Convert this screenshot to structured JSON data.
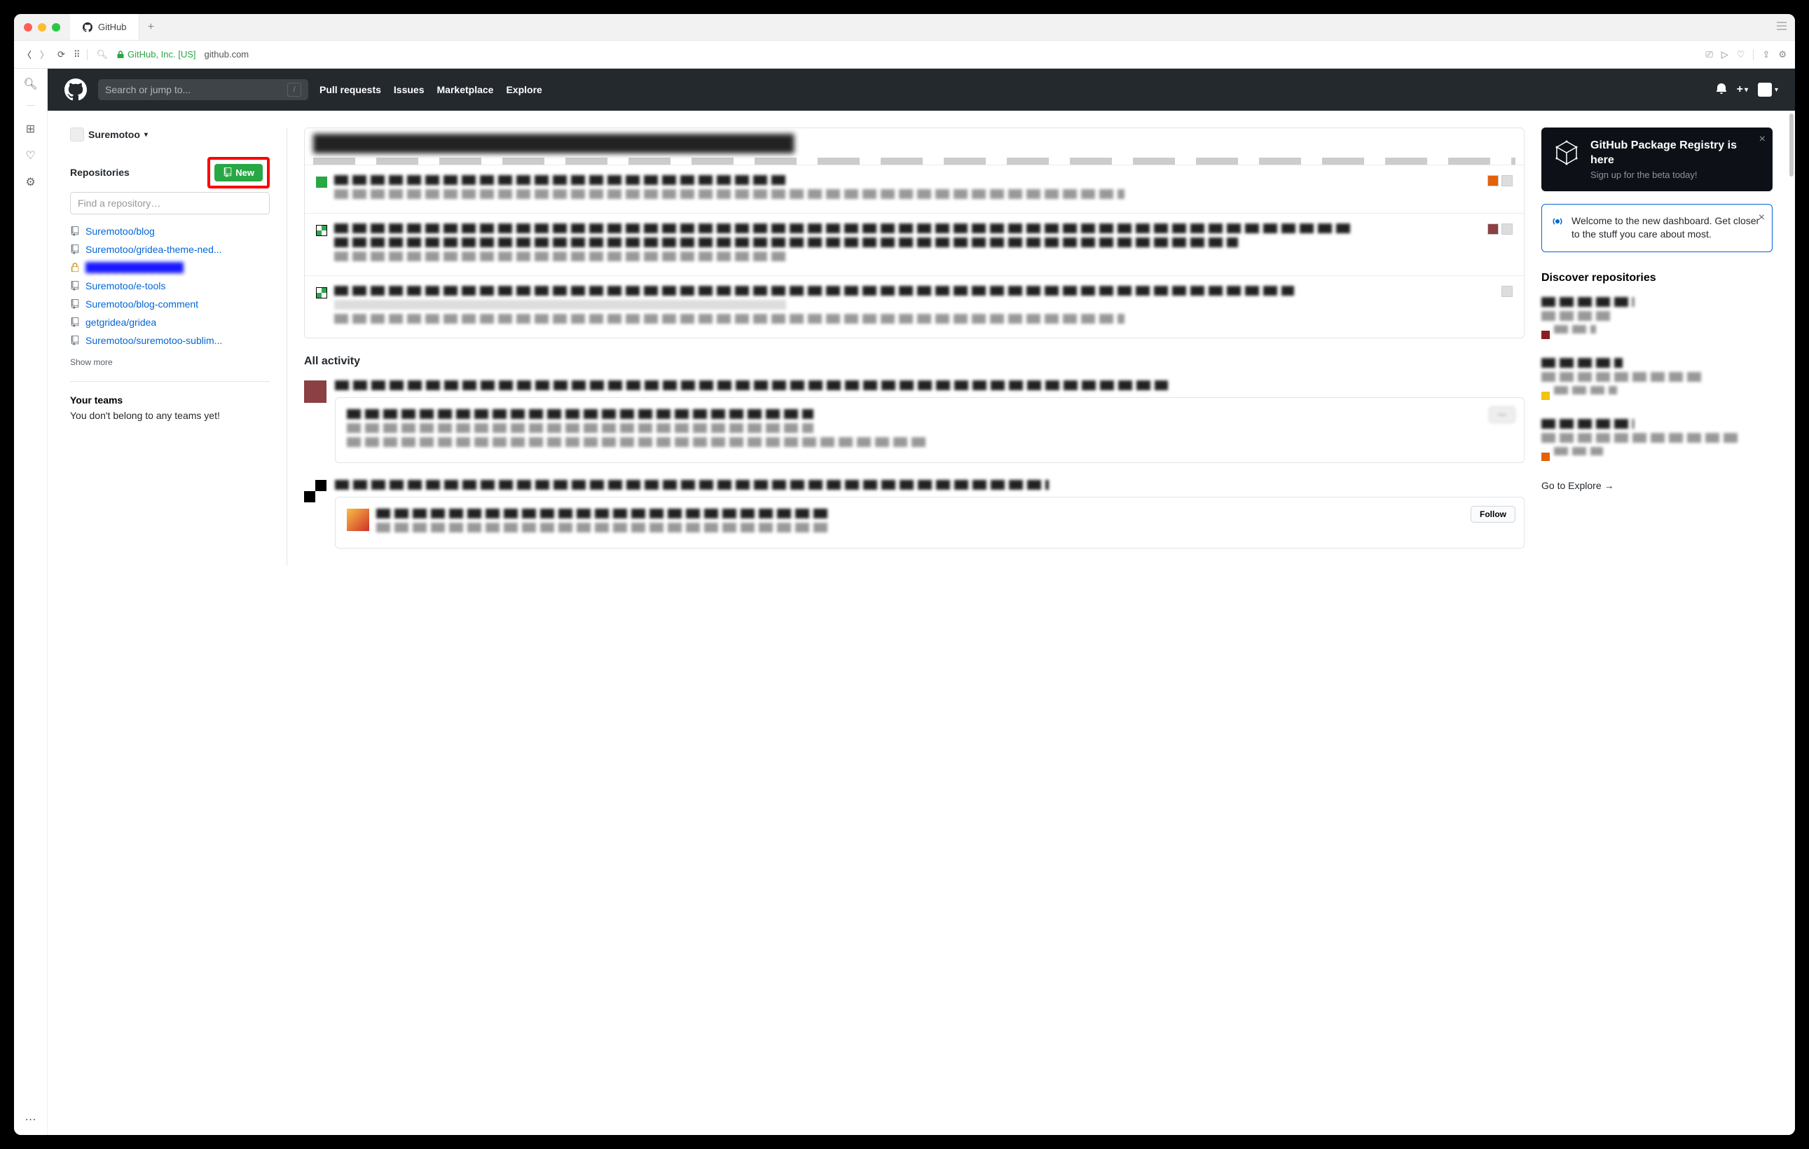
{
  "browser": {
    "tab_title": "GitHub",
    "ssl_org": "GitHub, Inc. [US]",
    "url": "github.com"
  },
  "header": {
    "search_placeholder": "Search or jump to...",
    "nav": {
      "pulls": "Pull requests",
      "issues": "Issues",
      "marketplace": "Marketplace",
      "explore": "Explore"
    }
  },
  "sidebar": {
    "user": "Suremotoo",
    "repos_heading": "Repositories",
    "new_button": "New",
    "find_placeholder": "Find a repository…",
    "repos": [
      "Suremotoo/blog",
      "Suremotoo/gridea-theme-ned...",
      "",
      "Suremotoo/e-tools",
      "Suremotoo/blog-comment",
      "getgridea/gridea",
      "Suremotoo/suremotoo-sublim..."
    ],
    "show_more": "Show more",
    "teams_heading": "Your teams",
    "teams_empty": "You don't belong to any teams yet!"
  },
  "feed": {
    "all_activity_heading": "All activity",
    "follow_button": "Follow"
  },
  "right": {
    "promo_title": "GitHub Package Registry is here",
    "promo_sub": "Sign up for the beta today!",
    "welcome_text": "Welcome to the new dashboard. Get closer to the stuff you care about most.",
    "discover_heading": "Discover repositories",
    "go_explore": "Go to Explore"
  }
}
